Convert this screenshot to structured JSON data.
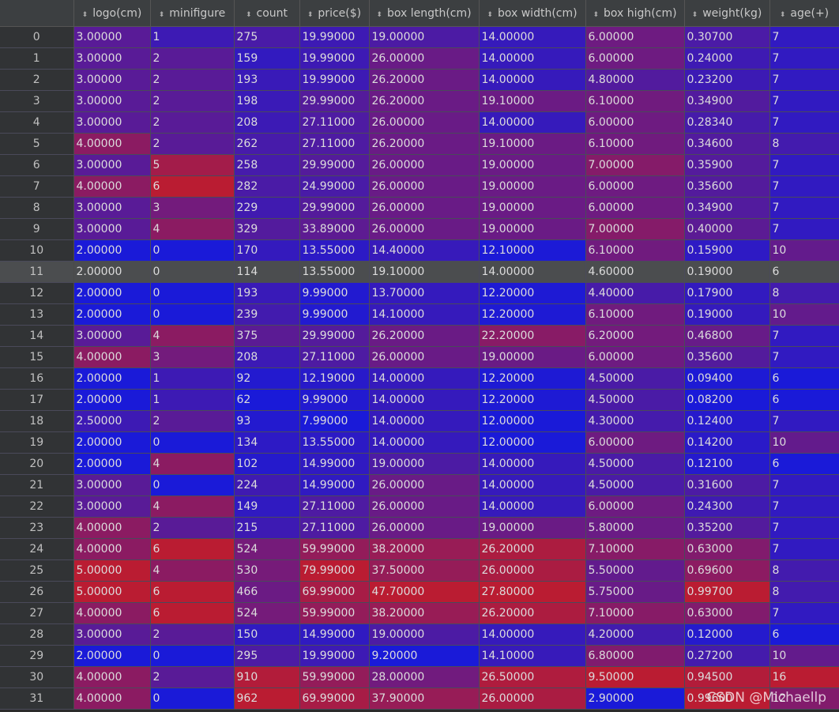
{
  "columns": [
    "logo(cm)",
    "minifigure",
    "count",
    "price($)",
    "box length(cm)",
    "box width(cm)",
    "box high(cm)",
    "weight(kg)",
    "age(+)"
  ],
  "selected_row_index": 11,
  "rows": [
    {
      "index": "0",
      "cells": [
        "3.00000",
        "1",
        "275",
        "19.99000",
        "19.00000",
        "14.00000",
        "6.00000",
        "0.30700",
        "7"
      ]
    },
    {
      "index": "1",
      "cells": [
        "3.00000",
        "2",
        "159",
        "19.99000",
        "26.00000",
        "14.00000",
        "6.00000",
        "0.24000",
        "7"
      ]
    },
    {
      "index": "2",
      "cells": [
        "3.00000",
        "2",
        "193",
        "19.99000",
        "26.20000",
        "14.00000",
        "4.80000",
        "0.23200",
        "7"
      ]
    },
    {
      "index": "3",
      "cells": [
        "3.00000",
        "2",
        "198",
        "29.99000",
        "26.20000",
        "19.10000",
        "6.10000",
        "0.34900",
        "7"
      ]
    },
    {
      "index": "4",
      "cells": [
        "3.00000",
        "2",
        "208",
        "27.11000",
        "26.00000",
        "14.00000",
        "6.00000",
        "0.28340",
        "7"
      ]
    },
    {
      "index": "5",
      "cells": [
        "4.00000",
        "2",
        "262",
        "27.11000",
        "26.20000",
        "19.10000",
        "6.10000",
        "0.34600",
        "8"
      ]
    },
    {
      "index": "6",
      "cells": [
        "3.00000",
        "5",
        "258",
        "29.99000",
        "26.00000",
        "19.00000",
        "7.00000",
        "0.35900",
        "7"
      ]
    },
    {
      "index": "7",
      "cells": [
        "4.00000",
        "6",
        "282",
        "24.99000",
        "26.00000",
        "19.00000",
        "6.00000",
        "0.35600",
        "7"
      ]
    },
    {
      "index": "8",
      "cells": [
        "3.00000",
        "3",
        "229",
        "29.99000",
        "26.00000",
        "19.00000",
        "6.00000",
        "0.34900",
        "7"
      ]
    },
    {
      "index": "9",
      "cells": [
        "3.00000",
        "4",
        "329",
        "33.89000",
        "26.00000",
        "19.00000",
        "7.00000",
        "0.40000",
        "7"
      ]
    },
    {
      "index": "10",
      "cells": [
        "2.00000",
        "0",
        "170",
        "13.55000",
        "14.40000",
        "12.10000",
        "6.10000",
        "0.15900",
        "10"
      ]
    },
    {
      "index": "11",
      "cells": [
        "2.00000",
        "0",
        "114",
        "13.55000",
        "19.10000",
        "14.00000",
        "4.60000",
        "0.19000",
        "6"
      ]
    },
    {
      "index": "12",
      "cells": [
        "2.00000",
        "0",
        "193",
        "9.99000",
        "13.70000",
        "12.20000",
        "4.40000",
        "0.17900",
        "8"
      ]
    },
    {
      "index": "13",
      "cells": [
        "2.00000",
        "0",
        "239",
        "9.99000",
        "14.10000",
        "12.20000",
        "6.10000",
        "0.19000",
        "10"
      ]
    },
    {
      "index": "14",
      "cells": [
        "3.00000",
        "4",
        "375",
        "29.99000",
        "26.20000",
        "22.20000",
        "6.20000",
        "0.46800",
        "7"
      ]
    },
    {
      "index": "15",
      "cells": [
        "4.00000",
        "3",
        "208",
        "27.11000",
        "26.00000",
        "19.00000",
        "6.00000",
        "0.35600",
        "7"
      ]
    },
    {
      "index": "16",
      "cells": [
        "2.00000",
        "1",
        "92",
        "12.19000",
        "14.00000",
        "12.20000",
        "4.50000",
        "0.09400",
        "6"
      ]
    },
    {
      "index": "17",
      "cells": [
        "2.00000",
        "1",
        "62",
        "9.99000",
        "14.00000",
        "12.20000",
        "4.50000",
        "0.08200",
        "6"
      ]
    },
    {
      "index": "18",
      "cells": [
        "2.50000",
        "2",
        "93",
        "7.99000",
        "14.00000",
        "12.00000",
        "4.30000",
        "0.12400",
        "7"
      ]
    },
    {
      "index": "19",
      "cells": [
        "2.00000",
        "0",
        "134",
        "13.55000",
        "14.00000",
        "12.00000",
        "6.00000",
        "0.14200",
        "10"
      ]
    },
    {
      "index": "20",
      "cells": [
        "2.00000",
        "4",
        "102",
        "14.99000",
        "19.00000",
        "14.00000",
        "4.50000",
        "0.12100",
        "6"
      ]
    },
    {
      "index": "21",
      "cells": [
        "3.00000",
        "0",
        "224",
        "14.99000",
        "26.00000",
        "14.00000",
        "4.50000",
        "0.31600",
        "7"
      ]
    },
    {
      "index": "22",
      "cells": [
        "3.00000",
        "4",
        "149",
        "27.11000",
        "26.00000",
        "14.00000",
        "6.00000",
        "0.24300",
        "7"
      ]
    },
    {
      "index": "23",
      "cells": [
        "4.00000",
        "2",
        "215",
        "27.11000",
        "26.00000",
        "19.00000",
        "5.80000",
        "0.35200",
        "7"
      ]
    },
    {
      "index": "24",
      "cells": [
        "4.00000",
        "6",
        "524",
        "59.99000",
        "38.20000",
        "26.20000",
        "7.10000",
        "0.63000",
        "7"
      ]
    },
    {
      "index": "25",
      "cells": [
        "5.00000",
        "4",
        "530",
        "79.99000",
        "37.50000",
        "26.00000",
        "5.50000",
        "0.69600",
        "8"
      ]
    },
    {
      "index": "26",
      "cells": [
        "5.00000",
        "6",
        "466",
        "69.99000",
        "47.70000",
        "27.80000",
        "5.75000",
        "0.99700",
        "8"
      ]
    },
    {
      "index": "27",
      "cells": [
        "4.00000",
        "6",
        "524",
        "59.99000",
        "38.20000",
        "26.20000",
        "7.10000",
        "0.63000",
        "7"
      ]
    },
    {
      "index": "28",
      "cells": [
        "3.00000",
        "2",
        "150",
        "14.99000",
        "19.00000",
        "14.00000",
        "4.20000",
        "0.12000",
        "6"
      ]
    },
    {
      "index": "29",
      "cells": [
        "2.00000",
        "0",
        "295",
        "19.99000",
        "9.20000",
        "14.10000",
        "6.80000",
        "0.27200",
        "10"
      ]
    },
    {
      "index": "30",
      "cells": [
        "4.00000",
        "2",
        "910",
        "59.99000",
        "28.00000",
        "26.50000",
        "9.50000",
        "0.94500",
        "16"
      ]
    },
    {
      "index": "31",
      "cells": [
        "4.00000",
        "0",
        "962",
        "69.99000",
        "37.90000",
        "26.00000",
        "2.90000",
        "0.99600",
        "12"
      ]
    }
  ],
  "watermark": "CSDN @Michaellp",
  "icons": {
    "sort": "sort-arrows-icon"
  },
  "colors": {
    "low": "#1a1ad8",
    "high": "#ba1c32",
    "selected_row": "#4b4d4f",
    "header_bg": "#3c3f41"
  }
}
